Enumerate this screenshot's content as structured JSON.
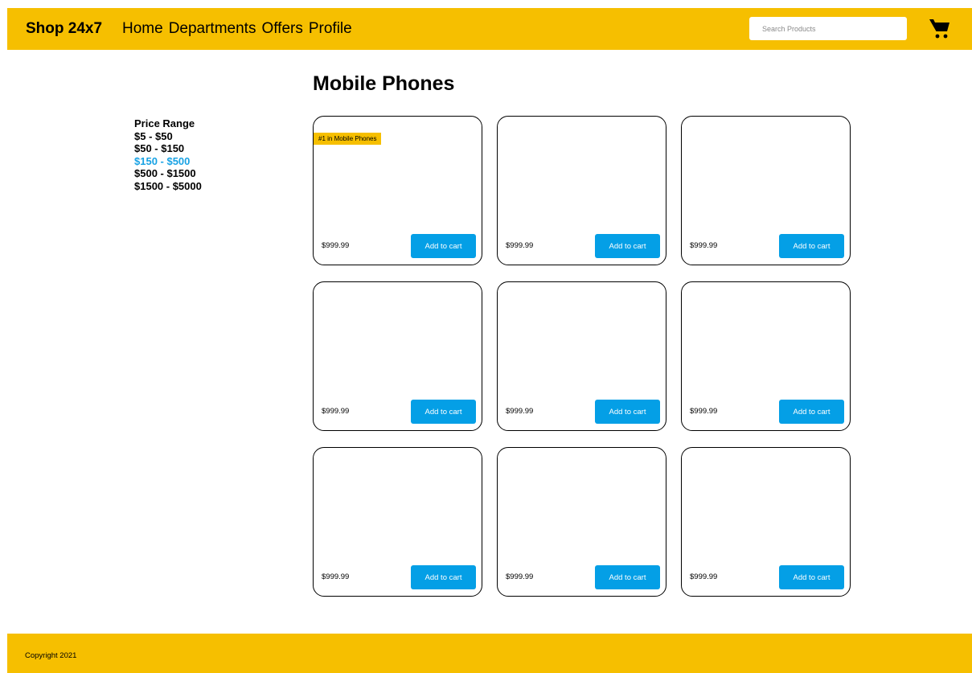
{
  "header": {
    "brand": "Shop 24x7",
    "nav": [
      "Home",
      "Departments",
      "Offers",
      "Profile"
    ],
    "search_placeholder": "Search Products",
    "cart_icon": "shopping-cart-icon"
  },
  "page_title": "Mobile Phones",
  "filters": {
    "title": "Price Range",
    "ranges": [
      "$5 - $50",
      "$50 - $150",
      "$150 - $500",
      "$500 - $1500",
      "$1500 - $5000"
    ],
    "selected": "$150 - $500"
  },
  "products": [
    {
      "badge": "#1 in Mobile Phones",
      "price": "$999.99",
      "button": "Add to cart"
    },
    {
      "price": "$999.99",
      "button": "Add to cart"
    },
    {
      "price": "$999.99",
      "button": "Add to cart"
    },
    {
      "price": "$999.99",
      "button": "Add to cart"
    },
    {
      "price": "$999.99",
      "button": "Add to cart"
    },
    {
      "price": "$999.99",
      "button": "Add to cart"
    },
    {
      "price": "$999.99",
      "button": "Add to cart"
    },
    {
      "price": "$999.99",
      "button": "Add to cart"
    },
    {
      "price": "$999.99",
      "button": "Add to cart"
    }
  ],
  "footer": {
    "copyright": "Copyright 2021"
  },
  "colors": {
    "brand_yellow": "#f6bf00",
    "accent_blue": "#049fe6",
    "selected_filter": "#18a2e4"
  }
}
